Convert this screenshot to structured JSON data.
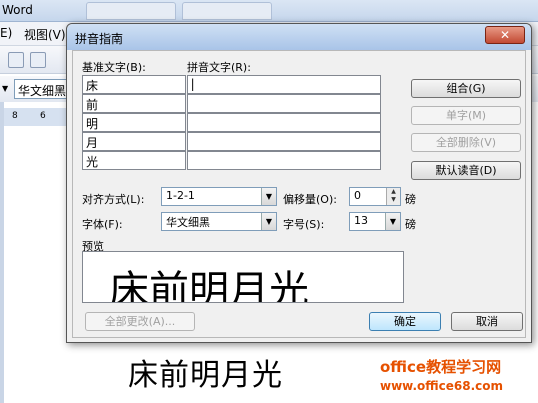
{
  "background": {
    "app_title": "Word",
    "menu_view": "视图(V)",
    "menu_edit_partial": "E)",
    "font_box": "华文细黑",
    "ruler_nums": [
      "8",
      "6"
    ],
    "bottom_text": "床前明月光",
    "watermark_line1": "office教程学习网",
    "watermark_line2": "www.office68.com"
  },
  "dialog": {
    "title": "拼音指南",
    "close_label": "✕",
    "header_base": "基准文字(B):",
    "header_pinyin": "拼音文字(R):",
    "rows": [
      {
        "base": "床",
        "pinyin": "|"
      },
      {
        "base": "前",
        "pinyin": ""
      },
      {
        "base": "明",
        "pinyin": ""
      },
      {
        "base": "月",
        "pinyin": ""
      },
      {
        "base": "光",
        "pinyin": ""
      }
    ],
    "buttons": {
      "group": "组合(G)",
      "single": "单字(M)",
      "delete_all": "全部删除(V)",
      "default_reading": "默认读音(D)",
      "change_all": "全部更改(A)...",
      "ok": "确定",
      "cancel": "取消"
    },
    "align_label": "对齐方式(L):",
    "align_value": "1-2-1",
    "offset_label": "偏移量(O):",
    "offset_value": "0",
    "offset_unit": "磅",
    "font_label": "字体(F):",
    "font_value": "华文细黑",
    "size_label": "字号(S):",
    "size_value": "13",
    "size_unit": "磅",
    "preview_label": "预览",
    "preview_text": "床前明月光"
  }
}
